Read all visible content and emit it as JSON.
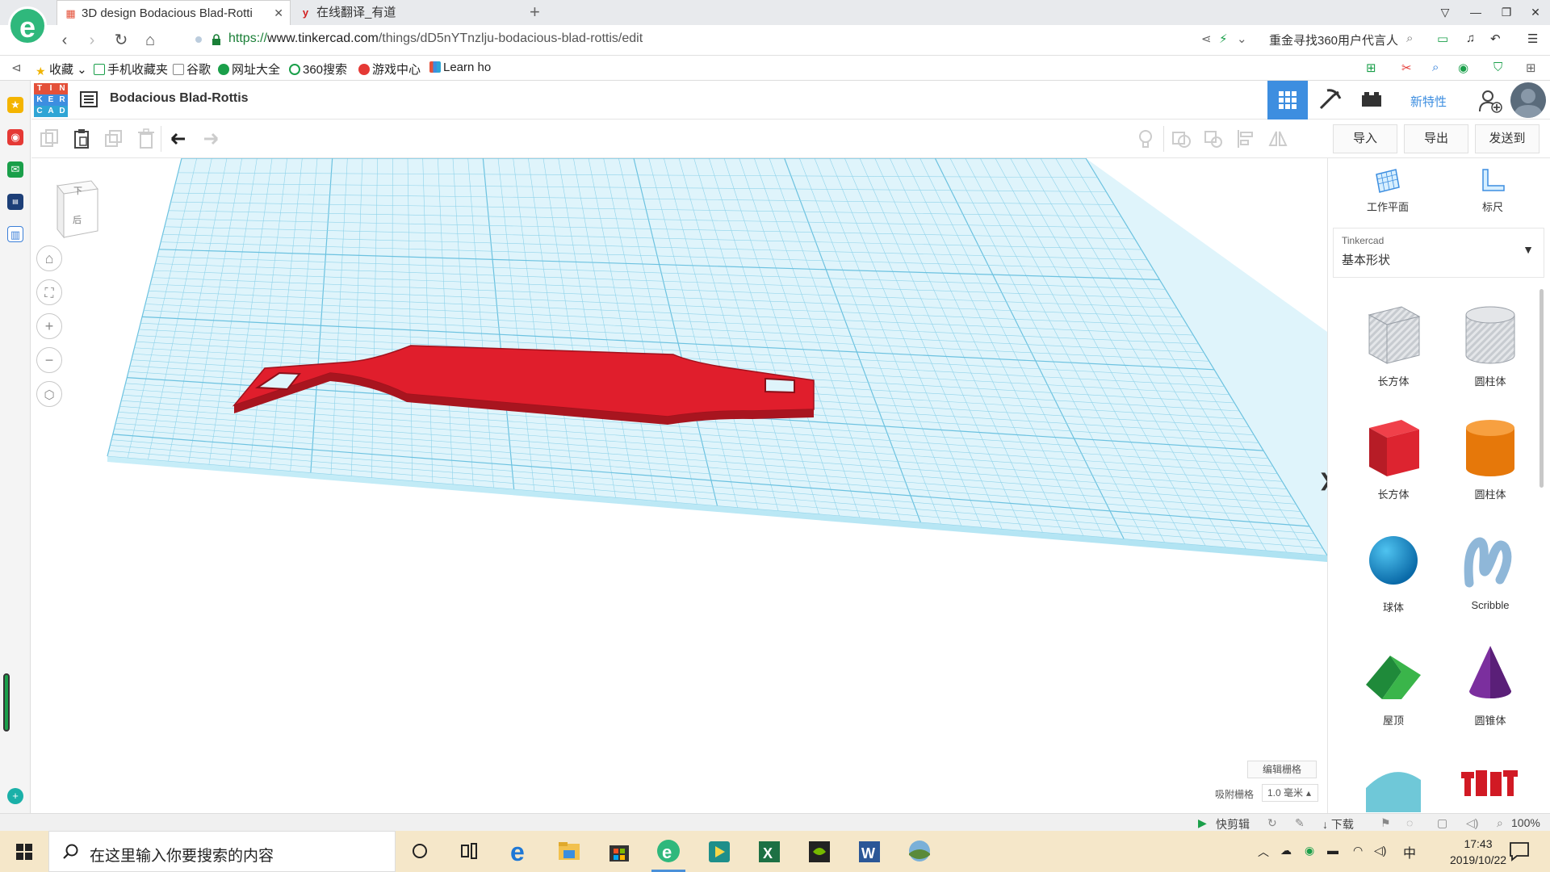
{
  "browser": {
    "tabs": [
      {
        "title": "3D design Bodacious Blad-Rotti",
        "active": true
      },
      {
        "title": "在线翻译_有道",
        "active": false
      }
    ],
    "new_tab_label": "+",
    "url_scheme": "https://",
    "url_host": "www.tinkercad.com",
    "url_path": "/things/dD5nYTnzlju-bodacious-blad-rottis/edit",
    "promo_text": "重金寻找360用户代言人",
    "bookmarks": [
      "收藏",
      "手机收藏夹",
      "谷歌",
      "网址大全",
      "360搜索",
      "游戏中心",
      "Learn ho"
    ]
  },
  "app": {
    "logo_letters": [
      "T",
      "I",
      "N",
      "K",
      "E",
      "R",
      "C",
      "A",
      "D"
    ],
    "logo_colors": [
      "#e4513a",
      "#e4513a",
      "#e4513a",
      "#3d8ee0",
      "#3d8ee0",
      "#3d8ee0",
      "#2fa5d5",
      "#2fa5d5",
      "#2fa5d5"
    ],
    "design_title": "Bodacious Blad-Rottis",
    "new_features": "新特性",
    "actions": {
      "import": "导入",
      "export": "导出",
      "send_to": "发送到"
    },
    "accent_color": "#3d8ee0"
  },
  "viewport": {
    "viewcube": {
      "top": "下",
      "front": "后"
    },
    "edit_grid": "编辑栅格",
    "snap_grid_label": "吸附栅格",
    "snap_grid_value": "1.0 毫米",
    "shape_color": "#e01e2c",
    "grid_color": "#8fd3ea"
  },
  "panel": {
    "tools": [
      {
        "label": "工作平面",
        "icon": "workplane-icon"
      },
      {
        "label": "标尺",
        "icon": "ruler-icon"
      }
    ],
    "category_source": "Tinkercad",
    "category": "基本形状",
    "shapes": [
      {
        "label": "长方体",
        "kind": "box-hole"
      },
      {
        "label": "圆柱体",
        "kind": "cylinder-hole"
      },
      {
        "label": "长方体",
        "kind": "box"
      },
      {
        "label": "圆柱体",
        "kind": "cylinder"
      },
      {
        "label": "球体",
        "kind": "sphere"
      },
      {
        "label": "Scribble",
        "kind": "scribble"
      },
      {
        "label": "屋顶",
        "kind": "roof"
      },
      {
        "label": "圆锥体",
        "kind": "cone"
      }
    ]
  },
  "status": {
    "quick_clip": "快剪辑",
    "download": "下载",
    "zoom": "100%"
  },
  "taskbar": {
    "search_placeholder": "在这里输入你要搜索的内容",
    "time": "17:43",
    "date": "2019/10/22",
    "ime": "中"
  }
}
